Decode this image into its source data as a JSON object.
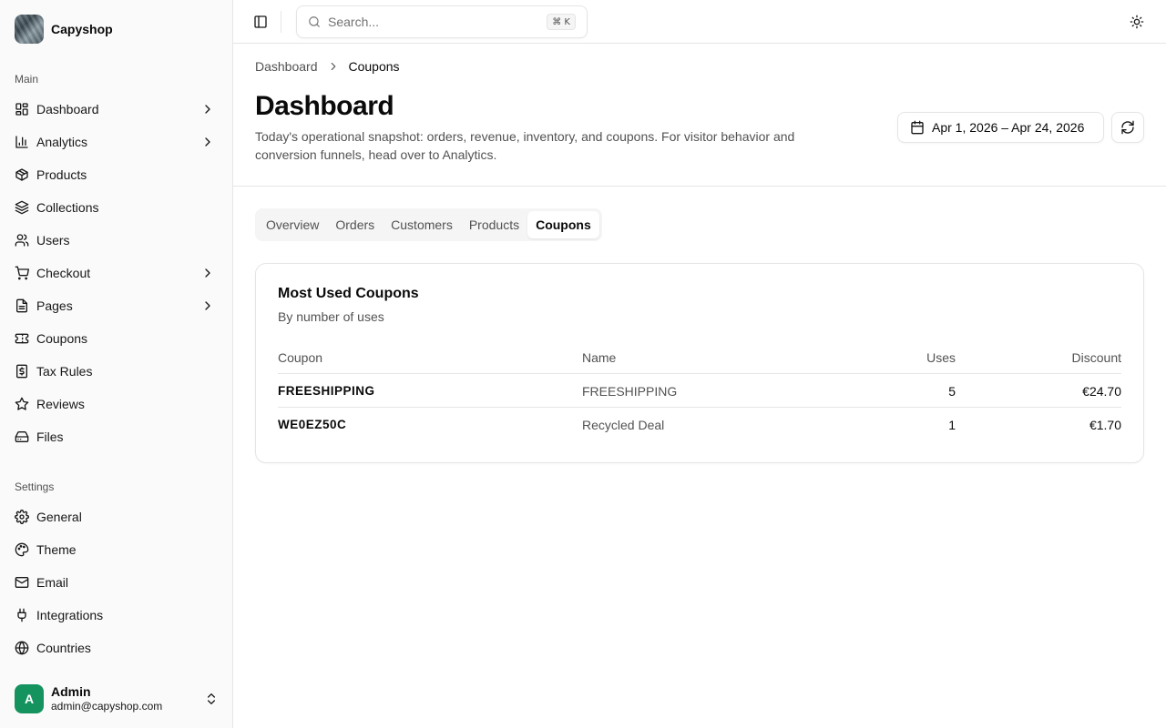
{
  "brand": {
    "name": "Capyshop"
  },
  "sidebar": {
    "main_label": "Main",
    "main_items": [
      {
        "label": "Dashboard",
        "icon": "dashboard-icon",
        "has_children": true
      },
      {
        "label": "Analytics",
        "icon": "bar-chart-icon",
        "has_children": true
      },
      {
        "label": "Products",
        "icon": "package-icon",
        "has_children": false
      },
      {
        "label": "Collections",
        "icon": "layers-icon",
        "has_children": false
      },
      {
        "label": "Users",
        "icon": "users-icon",
        "has_children": false
      },
      {
        "label": "Checkout",
        "icon": "cart-icon",
        "has_children": true
      },
      {
        "label": "Pages",
        "icon": "file-icon",
        "has_children": true
      },
      {
        "label": "Coupons",
        "icon": "ticket-icon",
        "has_children": false
      },
      {
        "label": "Tax Rules",
        "icon": "dollar-receipt-icon",
        "has_children": false
      },
      {
        "label": "Reviews",
        "icon": "star-icon",
        "has_children": false
      },
      {
        "label": "Files",
        "icon": "hard-drive-icon",
        "has_children": false
      }
    ],
    "settings_label": "Settings",
    "settings_items": [
      {
        "label": "General",
        "icon": "gear-icon"
      },
      {
        "label": "Theme",
        "icon": "palette-icon"
      },
      {
        "label": "Email",
        "icon": "mail-icon"
      },
      {
        "label": "Integrations",
        "icon": "plug-icon"
      },
      {
        "label": "Countries",
        "icon": "globe-icon"
      }
    ],
    "user": {
      "initial": "A",
      "name": "Admin",
      "email": "admin@capyshop.com",
      "avatar_color": "#15935f"
    }
  },
  "topbar": {
    "search_placeholder": "Search...",
    "search_shortcut": "⌘ K"
  },
  "breadcrumb": {
    "parent": "Dashboard",
    "current": "Coupons"
  },
  "header": {
    "title": "Dashboard",
    "description": "Today's operational snapshot: orders, revenue, inventory, and coupons. For visitor behavior and conversion funnels, head over to Analytics.",
    "date_range": "Apr 1, 2026 – Apr 24, 2026"
  },
  "tabs": [
    {
      "label": "Overview",
      "active": false
    },
    {
      "label": "Orders",
      "active": false
    },
    {
      "label": "Customers",
      "active": false
    },
    {
      "label": "Products",
      "active": false
    },
    {
      "label": "Coupons",
      "active": true
    }
  ],
  "card": {
    "title": "Most Used Coupons",
    "subtitle": "By number of uses",
    "columns": {
      "coupon": "Coupon",
      "name": "Name",
      "uses": "Uses",
      "discount": "Discount"
    },
    "rows": [
      {
        "coupon": "FREESHIPPING",
        "name": "FREESHIPPING",
        "uses": "5",
        "discount": "€24.70"
      },
      {
        "coupon": "WE0EZ50C",
        "name": "Recycled Deal",
        "uses": "1",
        "discount": "€1.70"
      }
    ]
  }
}
